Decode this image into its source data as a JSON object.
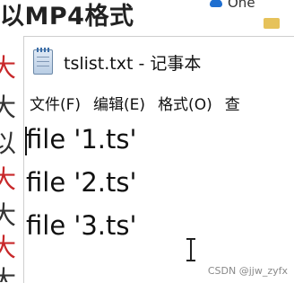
{
  "background": {
    "title": "以MP4格式",
    "side_chars": [
      "大",
      "大",
      "以",
      "大",
      "大",
      "大",
      "大"
    ],
    "top_right_label": "One"
  },
  "window": {
    "title": "tslist.txt - 记事本",
    "menu": [
      "文件(F)",
      "编辑(E)",
      "格式(O)",
      "查"
    ],
    "lines": [
      "file '1.ts'",
      "file '2.ts'",
      "file '3.ts'"
    ]
  },
  "watermark": "CSDN @jjw_zyfx"
}
